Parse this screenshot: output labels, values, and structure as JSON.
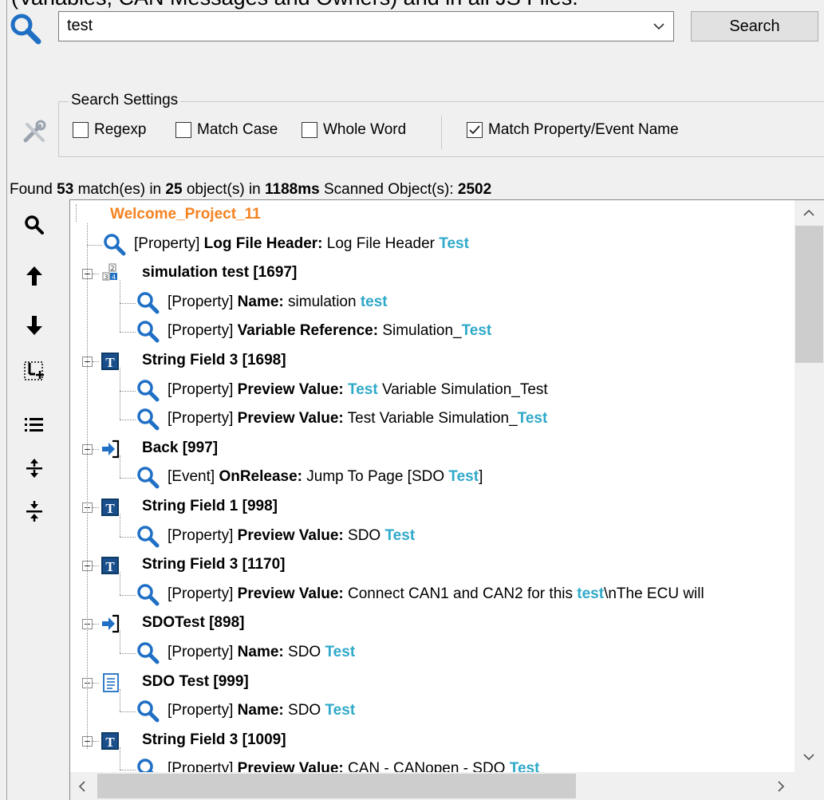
{
  "caption": "(Variables, CAN Messages and Owners) and in all JS Files.",
  "search": {
    "value": "test",
    "button_label": "Search"
  },
  "settings": {
    "legend": "Search Settings",
    "options": [
      {
        "label": "Regexp",
        "checked": false
      },
      {
        "label": "Match Case",
        "checked": false
      },
      {
        "label": "Whole Word",
        "checked": false
      },
      {
        "label": "Match Property/Event Name",
        "checked": true
      }
    ]
  },
  "found": {
    "prefix": "Found",
    "matches": "53",
    "mid1": "match(es) in",
    "objects": "25",
    "mid2": "object(s) in",
    "time": "1188ms",
    "mid3": "Scanned Object(s):",
    "scanned": "2502"
  },
  "toolbar": {
    "icons": [
      "search-icon",
      "arrow-up-icon",
      "arrow-down-icon",
      "select-add-icon",
      "list-icon",
      "expand-icon",
      "collapse-icon"
    ]
  },
  "tree": {
    "root": "Welcome_Project_11",
    "groups": [
      {
        "object": null,
        "icon": null,
        "results": [
          {
            "kind": "[Property]",
            "name": "Log File Header:",
            "before": "Log File Header",
            "match": "Test",
            "after": ""
          }
        ]
      },
      {
        "object": "simulation test [1697]",
        "icon": "simulation-icon",
        "results": [
          {
            "kind": "[Property]",
            "name": "Name:",
            "before": "simulation",
            "match": "test",
            "after": ""
          },
          {
            "kind": "[Property]",
            "name": "Variable Reference:",
            "before": "Simulation_",
            "match": "Test",
            "after": ""
          }
        ]
      },
      {
        "object": "String Field 3 [1698]",
        "icon": "string-field-icon",
        "results": [
          {
            "kind": "[Property]",
            "name": "Preview Value:",
            "before": "",
            "match": "Test",
            "after": "Variable Simulation_Test"
          },
          {
            "kind": "[Property]",
            "name": "Preview Value:",
            "before": "Test Variable Simulation_",
            "match": "Test",
            "after": ""
          }
        ]
      },
      {
        "object": "Back [997]",
        "icon": "jump-icon",
        "results": [
          {
            "kind": "[Event]",
            "name": "OnRelease:",
            "before": "Jump To Page [SDO",
            "match": "Test",
            "after": "]"
          }
        ]
      },
      {
        "object": "String Field 1 [998]",
        "icon": "string-field-icon",
        "results": [
          {
            "kind": "[Property]",
            "name": "Preview Value:",
            "before": "SDO",
            "match": "Test",
            "after": ""
          }
        ]
      },
      {
        "object": "String Field 3 [1170]",
        "icon": "string-field-icon",
        "results": [
          {
            "kind": "[Property]",
            "name": "Preview Value:",
            "before": "Connect CAN1 and CAN2 for this",
            "match": "test",
            "after": "\\nThe ECU will"
          }
        ]
      },
      {
        "object": "SDOTest [898]",
        "icon": "jump-icon",
        "results": [
          {
            "kind": "[Property]",
            "name": "Name:",
            "before": "SDO",
            "match": "Test",
            "after": ""
          }
        ]
      },
      {
        "object": "SDO Test [999]",
        "icon": "page-icon",
        "results": [
          {
            "kind": "[Property]",
            "name": "Name:",
            "before": "SDO",
            "match": "Test",
            "after": ""
          }
        ]
      },
      {
        "object": "String Field 3 [1009]",
        "icon": "string-field-icon",
        "results": [
          {
            "kind": "[Property]",
            "name": "Preview Value:",
            "before": "CAN - CANopen - SDO",
            "match": "Test",
            "after": ""
          }
        ]
      }
    ]
  },
  "colors": {
    "root": "#f58220",
    "highlight": "#2fa9c9",
    "search_icon": "#1f6fc5"
  }
}
